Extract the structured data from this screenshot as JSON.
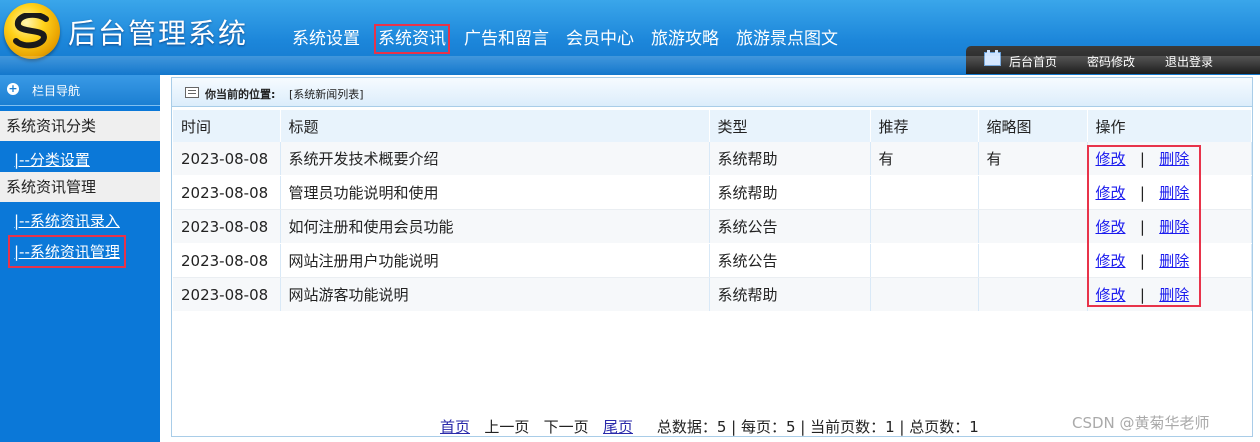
{
  "app": {
    "title": "后台管理系统"
  },
  "top_nav": [
    {
      "label": "系统设置"
    },
    {
      "label": "系统资讯"
    },
    {
      "label": "广告和留言"
    },
    {
      "label": "会员中心"
    },
    {
      "label": "旅游攻略"
    },
    {
      "label": "旅游景点图文"
    }
  ],
  "toolbar": {
    "home": "后台首页",
    "password": "密码修改",
    "logout": "退出登录"
  },
  "sidebar": {
    "title": "栏目导航",
    "cat1": "系统资讯分类",
    "link1": "|--分类设置",
    "cat2": "系统资讯管理",
    "link2": "|--系统资讯录入",
    "link3": "|--系统资讯管理"
  },
  "breadcrumb": {
    "label": "你当前的位置:",
    "value": "[系统新闻列表]"
  },
  "table": {
    "headers": [
      "时间",
      "标题",
      "类型",
      "推荐",
      "缩略图",
      "操作"
    ],
    "rows": [
      {
        "time": "2023-08-08",
        "title": "系统开发技术概要介绍",
        "type": "系统帮助",
        "recommend": "有",
        "thumb": "有",
        "edit": "修改",
        "sep": "|",
        "delete": "删除"
      },
      {
        "time": "2023-08-08",
        "title": "管理员功能说明和使用",
        "type": "系统帮助",
        "recommend": "",
        "thumb": "",
        "edit": "修改",
        "sep": "|",
        "delete": "删除"
      },
      {
        "time": "2023-08-08",
        "title": "如何注册和使用会员功能",
        "type": "系统公告",
        "recommend": "",
        "thumb": "",
        "edit": "修改",
        "sep": "|",
        "delete": "删除"
      },
      {
        "time": "2023-08-08",
        "title": "网站注册用户功能说明",
        "type": "系统公告",
        "recommend": "",
        "thumb": "",
        "edit": "修改",
        "sep": "|",
        "delete": "删除"
      },
      {
        "time": "2023-08-08",
        "title": "网站游客功能说明",
        "type": "系统帮助",
        "recommend": "",
        "thumb": "",
        "edit": "修改",
        "sep": "|",
        "delete": "删除"
      }
    ]
  },
  "pager": {
    "first": "首页",
    "prev": "上一页",
    "next": "下一页",
    "last": "尾页",
    "summary": "总数据：5 | 每页：5 | 当前页数：1 | 总页数：1"
  },
  "watermark": "CSDN @黄菊华老师",
  "colors": {
    "header": "#1c86da",
    "sidebar": "#0b78d8",
    "highlight": "#e8334a",
    "link": "#1a1aee"
  }
}
